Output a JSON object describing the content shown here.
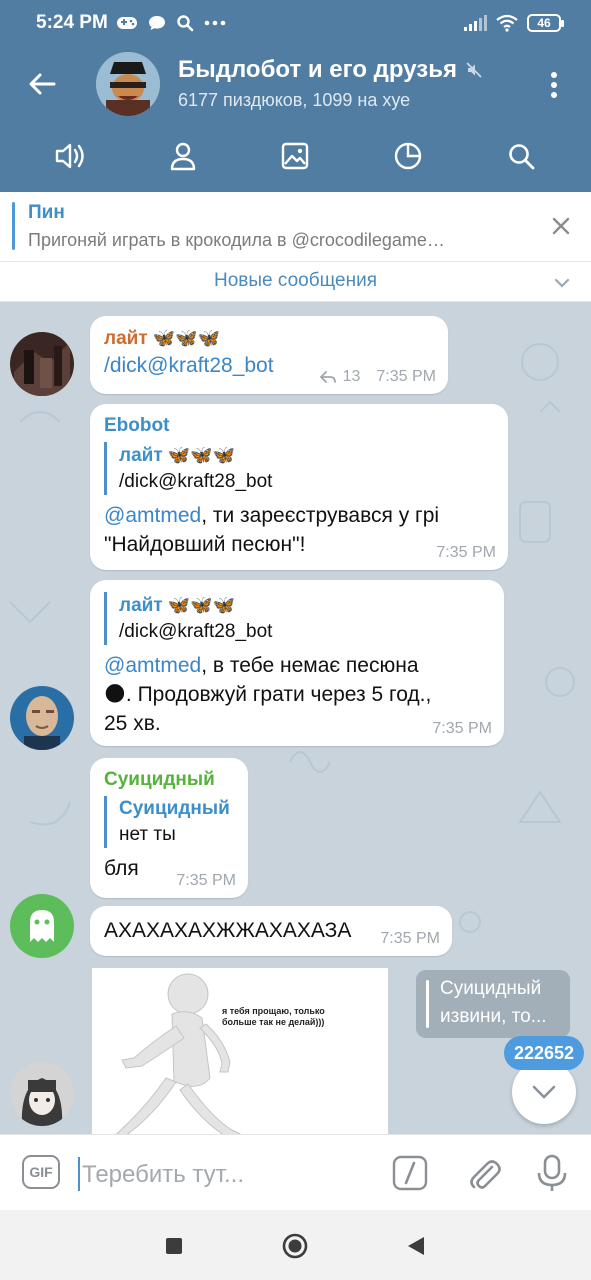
{
  "status_bar": {
    "time": "5:24 PM",
    "battery": "46"
  },
  "header": {
    "title": "Быдлобот и его друзья",
    "subtitle": "6177 пиздюков, 1099 на хуе"
  },
  "pinned": {
    "title": "Пин",
    "text": "Пригоняй играть в крокодила в @crocodilegame…"
  },
  "new_messages": "Новые сообщения",
  "messages": [
    {
      "sender": "лайт",
      "sender_emoji": "🦋🦋🦋",
      "text": "/dick@kraft28_bot",
      "replies_count": "13",
      "time": "7:35 PM"
    },
    {
      "sender": "Ebobot",
      "reply_name": "лайт",
      "reply_emoji": "🦋🦋🦋",
      "reply_text": "/dick@kraft28_bot",
      "mention": "@amtmed",
      "text": ", ти зареєструвався у грі \"Найдовший песюн\"!",
      "time": "7:35 PM"
    },
    {
      "reply_name": "лайт",
      "reply_emoji": "🦋🦋🦋",
      "reply_text": "/dick@kraft28_bot",
      "mention": "@amtmed",
      "text_line1": ", в тебе немає песюна",
      "emoji": "🌑",
      "text_line2": ". Продовжуй грати через 5 год.,",
      "text_line3": "25 хв.",
      "time": "7:35 PM"
    },
    {
      "sender": "Суицидный",
      "reply_name": "Суицидный",
      "reply_text": "нет ты",
      "text": "бля",
      "time": "7:35 PM"
    },
    {
      "text": "АХАХАХАХЖЖАХАХАЗА",
      "time": "7:35 PM"
    }
  ],
  "image_message": {
    "caption": "я тебя прощаю, только больше так не делай)))"
  },
  "forward_preview": {
    "name": "Суицидный",
    "text": "извини, то..."
  },
  "unread_count": "222652",
  "input": {
    "placeholder": "Теребить тут..."
  },
  "colors": {
    "header_bg": "#527da3",
    "chat_bg": "#c8d3dc",
    "accent": "#3d8fc9",
    "green_name": "#54b33a"
  }
}
